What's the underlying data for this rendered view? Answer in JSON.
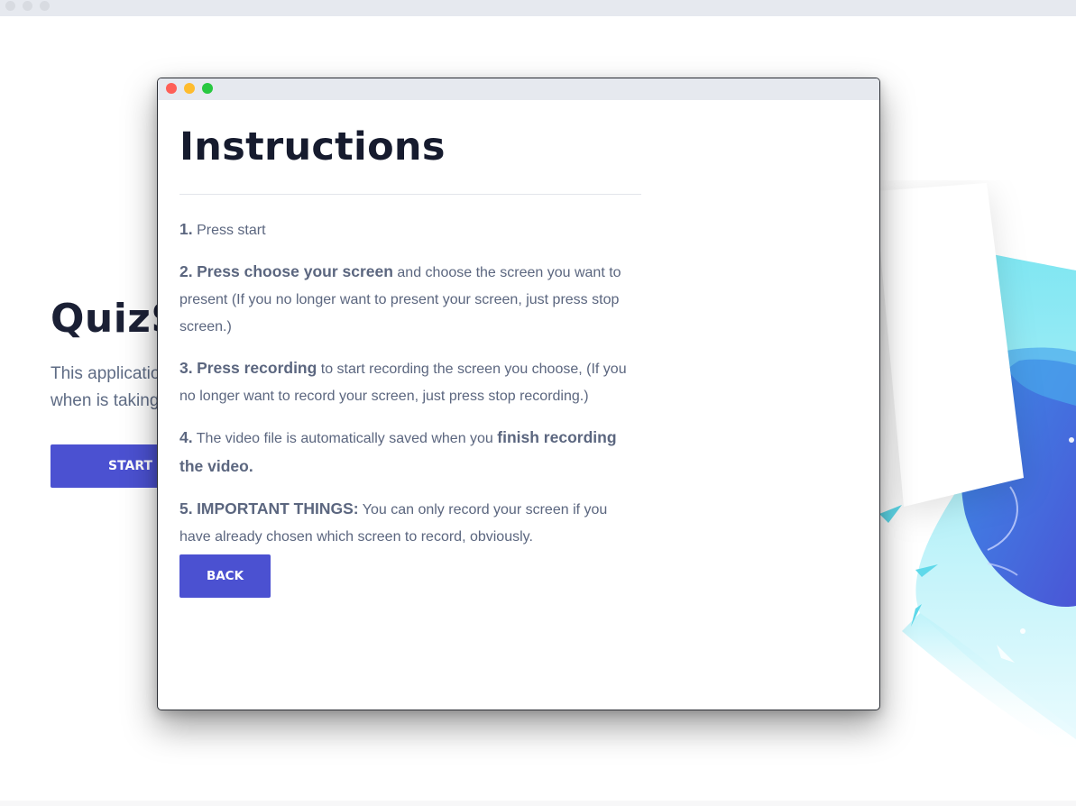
{
  "background": {
    "title": "QuizScreen",
    "description_line1": "This application",
    "description_line2": "when is taking",
    "start_label": "START"
  },
  "modal": {
    "heading": "Instructions",
    "steps": [
      {
        "num": "1.",
        "text": "Press start"
      },
      {
        "num": "2.",
        "bold": "Press choose your screen",
        "text": " and choose the screen you want to present (If you no longer want to present your screen, just press stop screen.)"
      },
      {
        "num": "3.",
        "bold": "Press recording",
        "text": " to start recording the screen you choose, (If you no longer want to record your screen, just press stop recording.)"
      },
      {
        "num": "4.",
        "text": "The video file is automatically saved when you ",
        "bold_end": "finish recording the video."
      },
      {
        "num": "5.",
        "bold": "IMPORTANT THINGS:",
        "text": " You can only record your screen if you have already chosen which screen to record, obviously."
      }
    ],
    "back_label": "BACK"
  },
  "colors": {
    "accent": "#4b51d1",
    "heading": "#161b2e",
    "body_text": "#5b667f",
    "traffic_red": "#fe5f57",
    "traffic_yellow": "#febc2e",
    "traffic_green": "#28c840"
  }
}
